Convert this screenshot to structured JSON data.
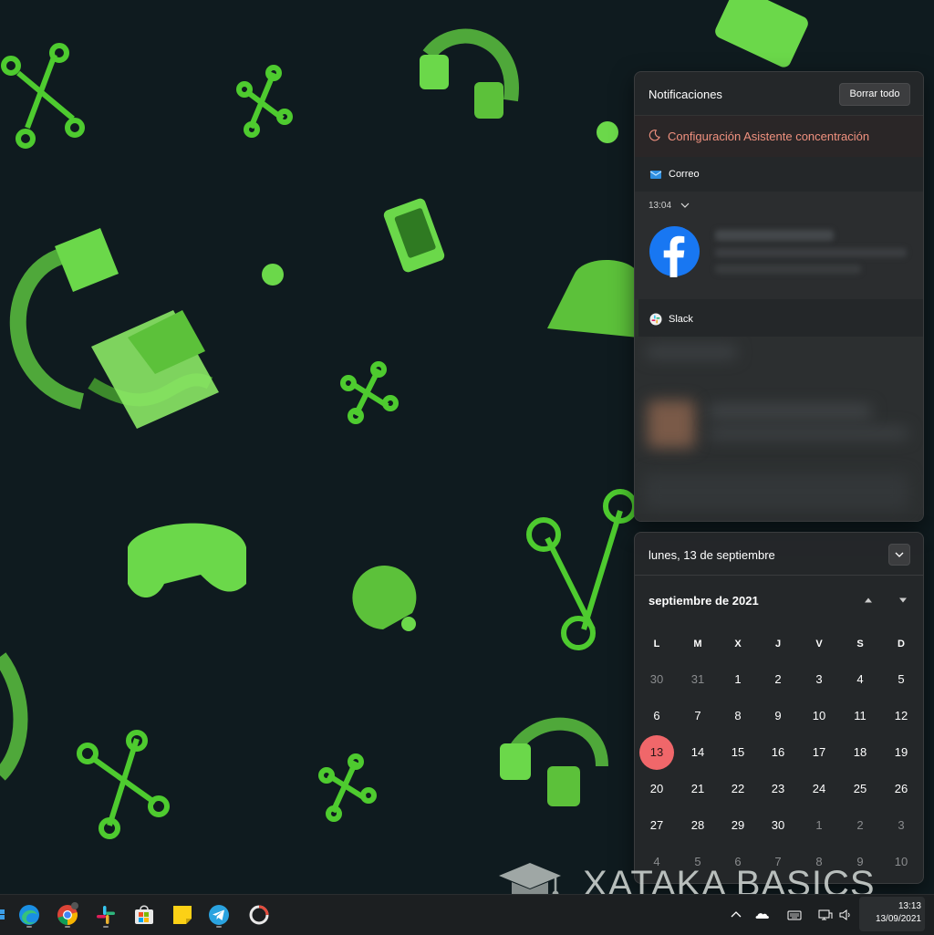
{
  "notifications": {
    "title": "Notificaciones",
    "clear_all": "Borrar todo",
    "focus_assist": "Configuración Asistente concentración",
    "apps": [
      {
        "name": "Correo",
        "time": "13:04"
      },
      {
        "name": "Slack"
      }
    ]
  },
  "calendar": {
    "date_header": "lunes, 13 de septiembre",
    "month_title": "septiembre de 2021",
    "weekdays": [
      "L",
      "M",
      "X",
      "J",
      "V",
      "S",
      "D"
    ],
    "weeks": [
      [
        "30",
        "31",
        "1",
        "2",
        "3",
        "4",
        "5"
      ],
      [
        "6",
        "7",
        "8",
        "9",
        "10",
        "11",
        "12"
      ],
      [
        "13",
        "14",
        "15",
        "16",
        "17",
        "18",
        "19"
      ],
      [
        "20",
        "21",
        "22",
        "23",
        "24",
        "25",
        "26"
      ],
      [
        "27",
        "28",
        "29",
        "30",
        "1",
        "2",
        "3"
      ],
      [
        "4",
        "5",
        "6",
        "7",
        "8",
        "9",
        "10"
      ]
    ],
    "today": "13"
  },
  "taskbar": {
    "apps": [
      "windows-start",
      "edge",
      "chrome",
      "slack",
      "microsoft-store",
      "sticky-notes",
      "telegram",
      "loading-app"
    ],
    "tray": [
      "chevron-up-icon",
      "onedrive-icon",
      "keyboard-icon",
      "network-icon",
      "volume-icon"
    ],
    "time": "13:13",
    "date": "13/09/2021"
  },
  "watermark": "XATAKA BASICS",
  "colors": {
    "accent_today": "#f0676a",
    "focus_link": "#f0917f",
    "wallpaper_bg": "#0f1b1f",
    "wallpaper_green": "#5fd33b"
  }
}
